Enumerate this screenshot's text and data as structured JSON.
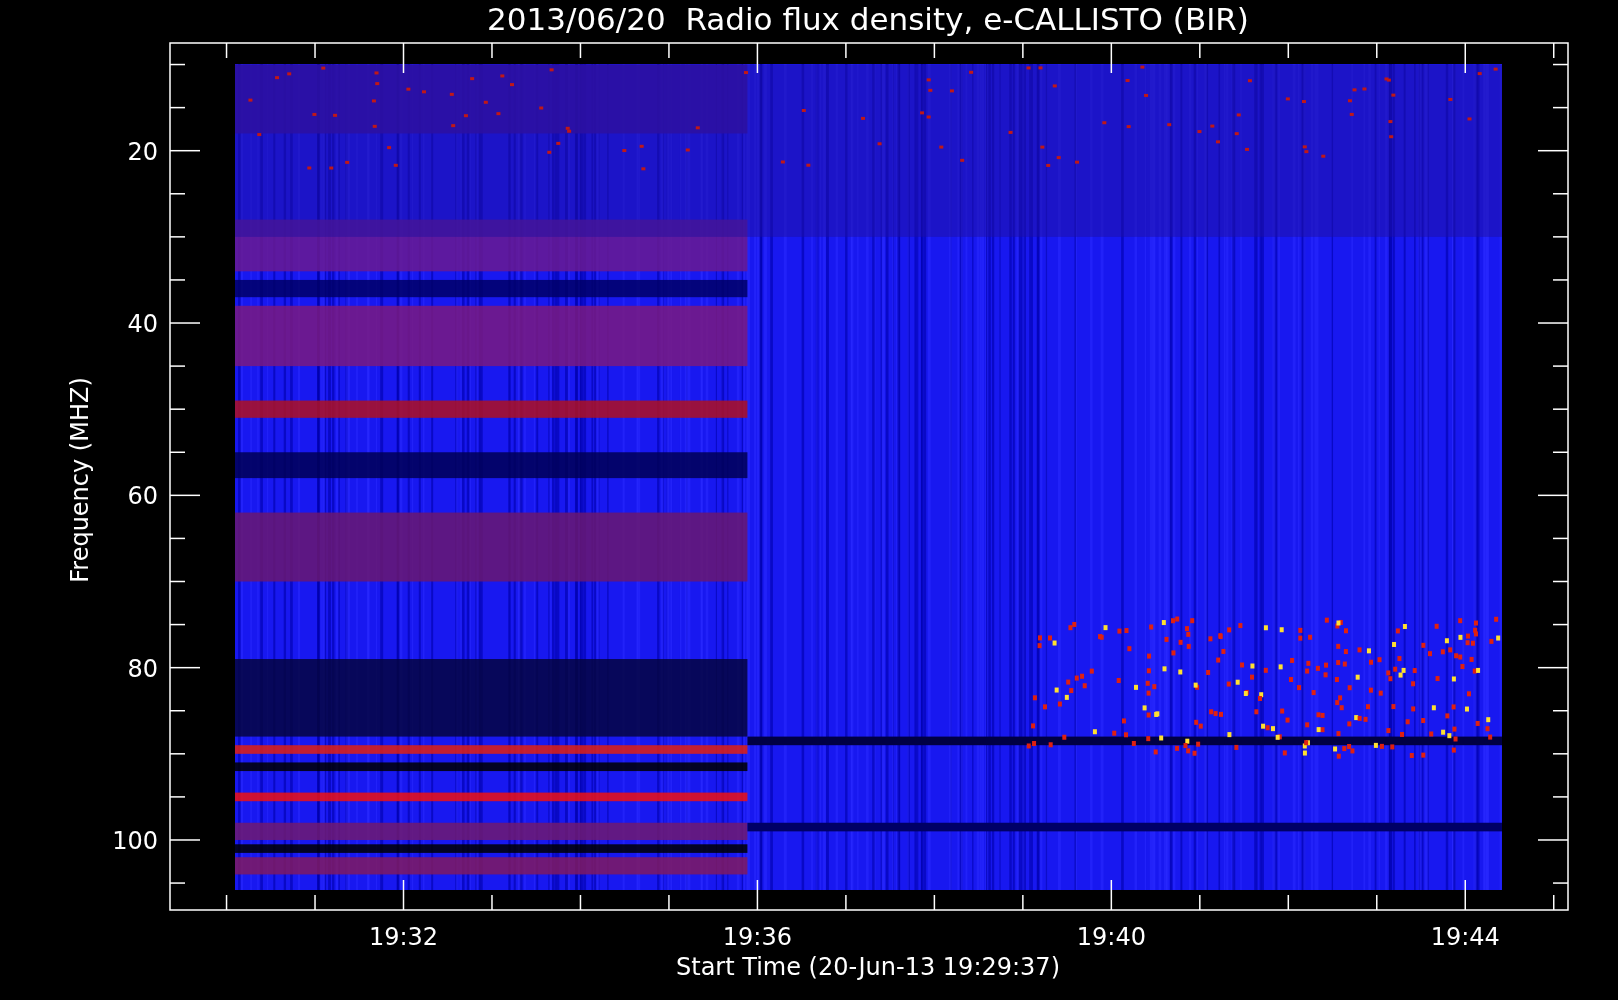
{
  "title": "2013/06/20  Radio flux density, e-CALLISTO (BIR)",
  "ylabel": "Frequency (MHZ)",
  "xlabel": "Start Time (20-Jun-13 19:29:37)",
  "yticks": [
    "20",
    "40",
    "60",
    "80",
    "100"
  ],
  "xticks": [
    "19:32",
    "19:36",
    "19:40",
    "19:44"
  ]
}
